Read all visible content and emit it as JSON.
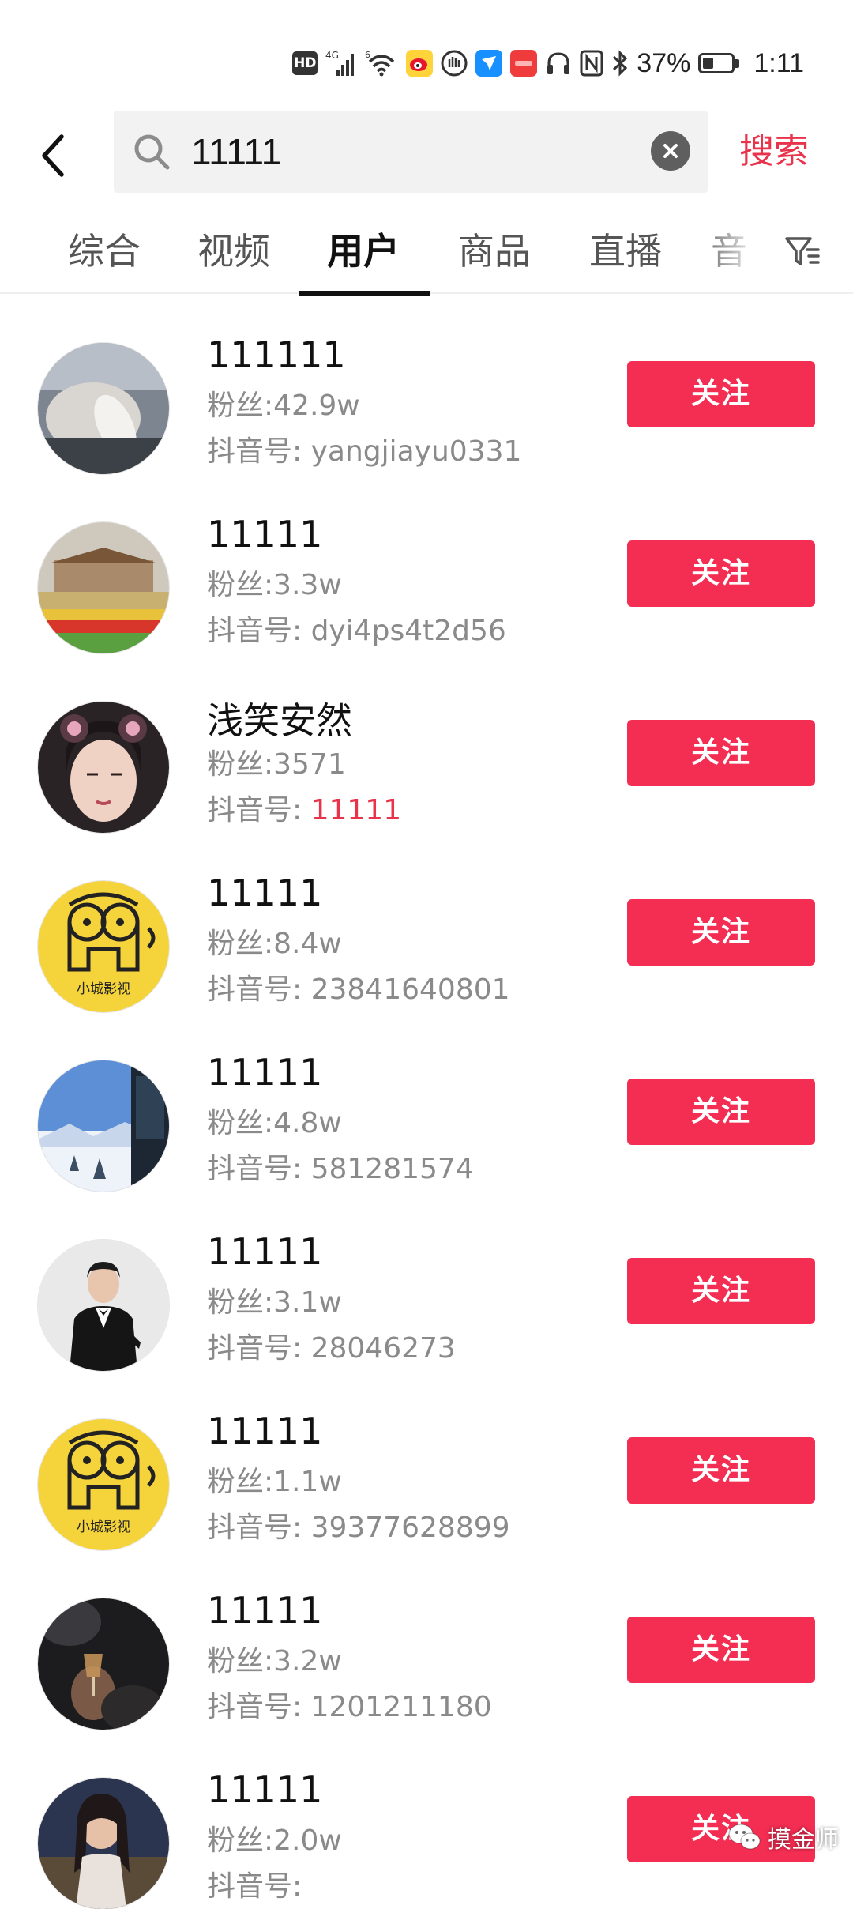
{
  "status_bar": {
    "network": "4G",
    "sim2": "6",
    "battery": "37%",
    "battery_level": 0.37,
    "time": "1:11"
  },
  "search": {
    "query": "11111",
    "submit_label": "搜索"
  },
  "tabs": [
    {
      "label": "综合",
      "active": false
    },
    {
      "label": "视频",
      "active": false
    },
    {
      "label": "用户",
      "active": true
    },
    {
      "label": "商品",
      "active": false
    },
    {
      "label": "直播",
      "active": false
    },
    {
      "label": "音",
      "active": false
    }
  ],
  "users": [
    {
      "name": "111111",
      "fans": "粉丝:42.9w",
      "id_prefix": "抖音号: ",
      "id_value": "yangjiayu0331",
      "id_highlight": false,
      "follow_label": "关注",
      "avatar": "photo-lying-person"
    },
    {
      "name": "11111",
      "fans": "粉丝:3.3w",
      "id_prefix": "抖音号: ",
      "id_value": "dyi4ps4t2d56",
      "id_highlight": false,
      "follow_label": "关注",
      "avatar": "photo-tiananmen-flowers"
    },
    {
      "name": "浅笑安然",
      "fans": "粉丝:3571",
      "id_prefix": "抖音号: ",
      "id_value": "11111",
      "id_highlight": true,
      "follow_label": "关注",
      "avatar": "photo-girl-bear-ears"
    },
    {
      "name": "11111",
      "fans": "粉丝:8.4w",
      "id_prefix": "抖音号: ",
      "id_value": "23841640801",
      "id_highlight": false,
      "follow_label": "关注",
      "avatar": "logo-xiaocheng-yingshi",
      "avatar_text": "小城影视"
    },
    {
      "name": "11111",
      "fans": "粉丝:4.8w",
      "id_prefix": "抖音号: ",
      "id_value": "581281574",
      "id_highlight": false,
      "follow_label": "关注",
      "avatar": "photo-snowy-landscape"
    },
    {
      "name": "11111",
      "fans": "粉丝:3.1w",
      "id_prefix": "抖音号: ",
      "id_value": "28046273",
      "id_highlight": false,
      "follow_label": "关注",
      "avatar": "photo-man-in-suit"
    },
    {
      "name": "11111",
      "fans": "粉丝:1.1w",
      "id_prefix": "抖音号: ",
      "id_value": "39377628899",
      "id_highlight": false,
      "follow_label": "关注",
      "avatar": "logo-xiaocheng-yingshi",
      "avatar_text": "小城影视"
    },
    {
      "name": "11111",
      "fans": "粉丝:3.2w",
      "id_prefix": "抖音号: ",
      "id_value": "1201211180",
      "id_highlight": false,
      "follow_label": "关注",
      "avatar": "photo-dark-drink"
    },
    {
      "name": "11111",
      "fans": "粉丝:2.0w",
      "id_prefix": "抖音号: ",
      "id_value": "",
      "id_highlight": false,
      "follow_label": "关注",
      "avatar": "photo-woman-night"
    }
  ],
  "watermark": {
    "text": "摸金师",
    "icon": "wechat-icon"
  },
  "colors": {
    "accent": "#f42d52",
    "search_link": "#e8334a",
    "highlight": "#e8334a",
    "secondary_text": "#8a8a8a"
  }
}
